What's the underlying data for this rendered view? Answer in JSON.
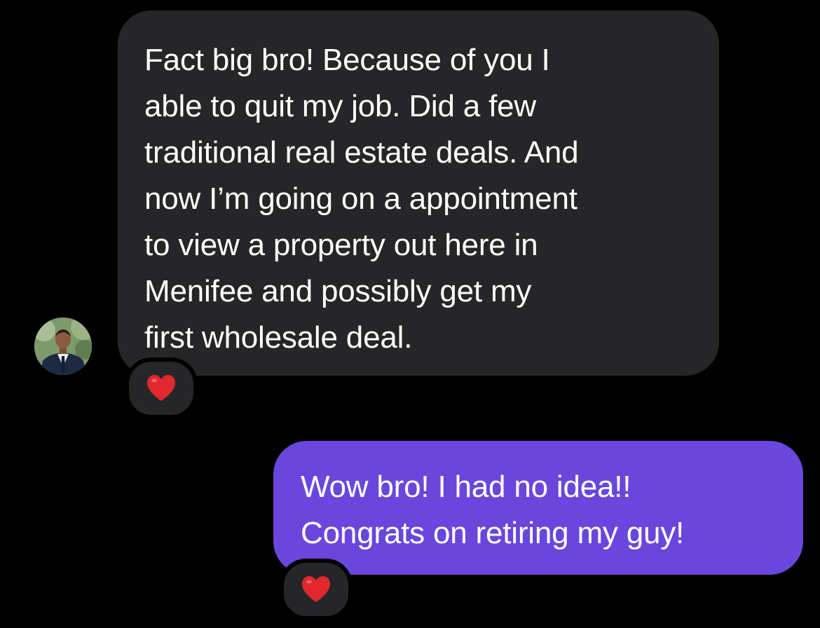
{
  "incoming": {
    "lines": [
      "Fact big bro! Because of you I",
      "able to quit my job. Did a few",
      "traditional real estate deals. And",
      "now I’m going on a appointment",
      "to view a property out here in",
      "Menifee and possibly get my",
      "first wholesale deal."
    ],
    "reaction": "heart-icon"
  },
  "outgoing": {
    "lines": [
      "Wow bro! I had no idea!!",
      "Congrats on retiring my guy!"
    ],
    "reaction": "heart-icon"
  },
  "colors": {
    "background": "#000000",
    "incoming_bubble": "#262628",
    "outgoing_bubble": "#6a46dc",
    "text": "#ffffff",
    "heart": "#e0282e"
  }
}
